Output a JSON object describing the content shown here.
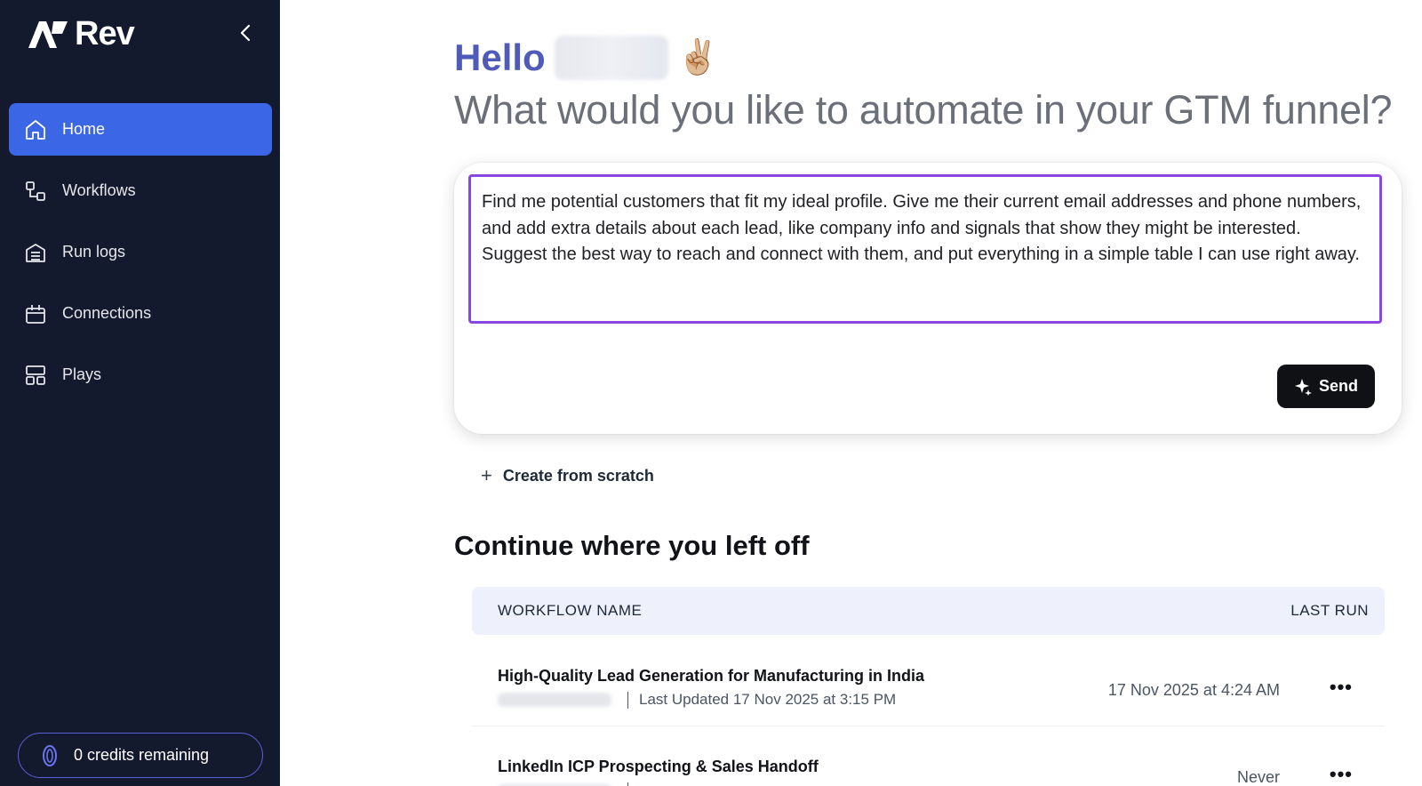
{
  "brand": {
    "name": "Rev",
    "accent": "#3b66e6",
    "sidebar_bg": "#141a2e",
    "prompt_border": "#8a46e0"
  },
  "sidebar": {
    "items": [
      {
        "label": "Home",
        "icon": "home-icon",
        "active": true
      },
      {
        "label": "Workflows",
        "icon": "workflow-icon",
        "active": false
      },
      {
        "label": "Run logs",
        "icon": "run-logs-icon",
        "active": false
      },
      {
        "label": "Connections",
        "icon": "connections-icon",
        "active": false
      },
      {
        "label": "Plays",
        "icon": "plays-icon",
        "active": false
      }
    ],
    "credits_label": "0 credits remaining"
  },
  "main": {
    "hello": "Hello",
    "wave_emoji": "✌🏼",
    "headline": "What would you like to automate in your GTM funnel?",
    "prompt_value": "Find me potential customers that fit my ideal profile. Give me their current email addresses and phone numbers, and add extra details about each lead, like company info and signals that show they might be interested. Suggest the best way to reach and connect with them, and put everything in a simple table I can use right away.",
    "send_label": "Send",
    "create_label": "Create from scratch",
    "section_title": "Continue where you left off",
    "table": {
      "headers": {
        "name": "WORKFLOW NAME",
        "last_run": "LAST RUN"
      },
      "rows": [
        {
          "title": "High-Quality Lead Generation for Manufacturing in India",
          "updated": "Last Updated 17 Nov 2025 at 3:15 PM",
          "last_run": "17 Nov 2025 at 4:24 AM"
        },
        {
          "title": "LinkedIn ICP Prospecting & Sales Handoff",
          "updated": "",
          "last_run": "Never"
        }
      ]
    }
  }
}
